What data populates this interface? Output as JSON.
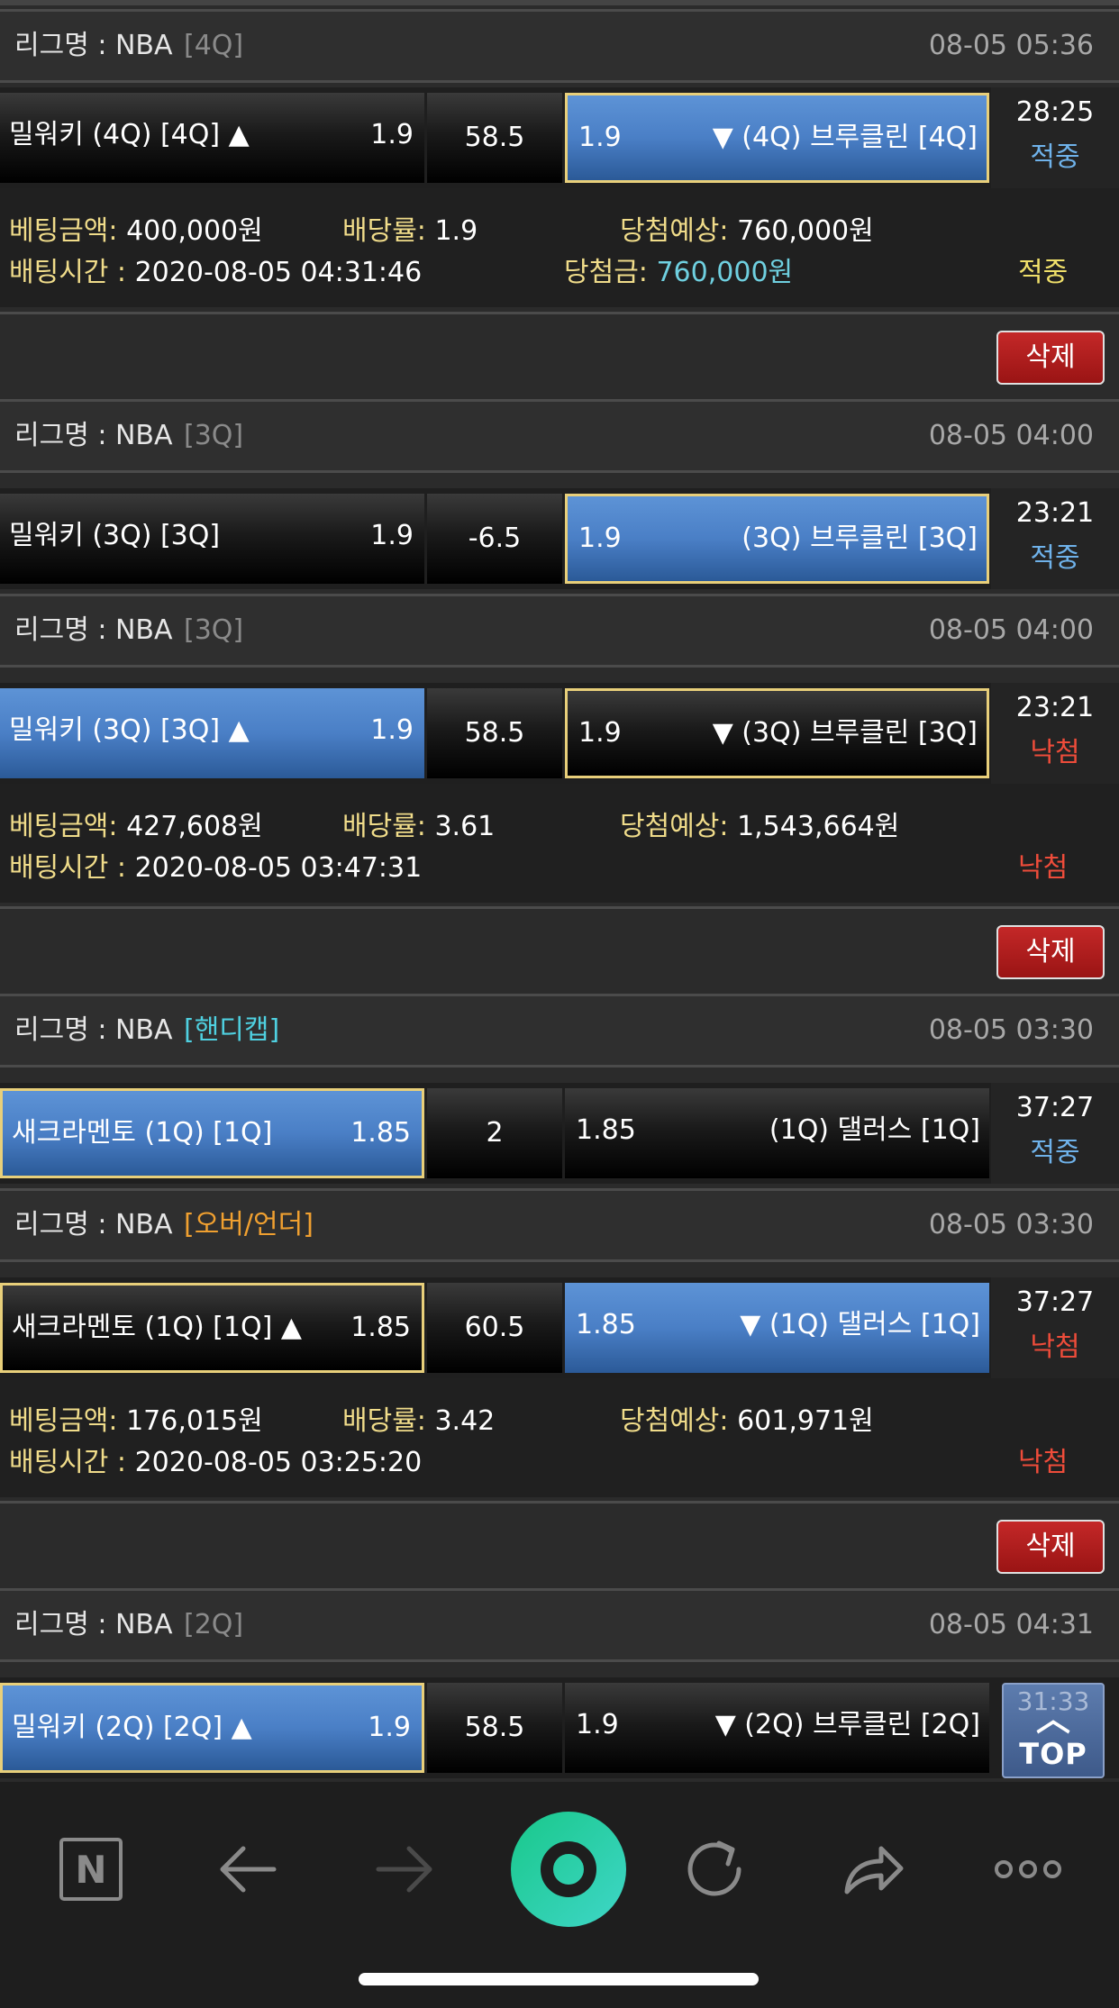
{
  "league_prefix": "리그명 : NBA",
  "bets": [
    {
      "tag": "[4Q]",
      "date": "08-05 05:36",
      "home": "밀워키 (4Q) [4Q] ▲",
      "home_odd": "1.9",
      "line": "58.5",
      "away_odd": "1.9",
      "away": "▼ (4Q) 브루클린 [4Q]",
      "time": "28:25",
      "result": "적중"
    },
    {
      "tag": "[3Q]",
      "date": "08-05 04:00",
      "home": "밀워키 (3Q) [3Q]",
      "home_odd": "1.9",
      "line": "-6.5",
      "away_odd": "1.9",
      "away": "(3Q) 브루클린 [3Q]",
      "time": "23:21",
      "result": "적중"
    },
    {
      "tag": "[3Q]",
      "date": "08-05 04:00",
      "home": "밀워키 (3Q) [3Q] ▲",
      "home_odd": "1.9",
      "line": "58.5",
      "away_odd": "1.9",
      "away": "▼ (3Q) 브루클린 [3Q]",
      "time": "23:21",
      "result": "낙첨"
    },
    {
      "tag": "[핸디캡]",
      "date": "08-05 03:30",
      "home": "새크라멘토 (1Q) [1Q]",
      "home_odd": "1.85",
      "line": "2",
      "away_odd": "1.85",
      "away": "(1Q) 댈러스 [1Q]",
      "time": "37:27",
      "result": "적중"
    },
    {
      "tag": "[오버/언더]",
      "date": "08-05 03:30",
      "home": "새크라멘토 (1Q) [1Q] ▲",
      "home_odd": "1.85",
      "line": "60.5",
      "away_odd": "1.85",
      "away": "▼ (1Q) 댈러스 [1Q]",
      "time": "37:27",
      "result": "낙첨"
    },
    {
      "tag": "[2Q]",
      "date": "08-05 04:31",
      "home": "밀워키 (2Q) [2Q] ▲",
      "home_odd": "1.9",
      "line": "58.5",
      "away_odd": "1.9",
      "away": "▼ (2Q) 브루클린 [2Q]",
      "time": "31:33",
      "result": ""
    }
  ],
  "labels": {
    "bet_amount": "베팅금액:",
    "odds": "배당률:",
    "expected": "당첨예상:",
    "bet_time": "배팅시간 :",
    "winnings": "당첨금:",
    "delete": "삭제",
    "top": "TOP"
  },
  "slips": [
    {
      "amount": "400,000원",
      "odds": "1.9",
      "expected": "760,000원",
      "time": "2020-08-05 04:31:46",
      "winnings": "760,000원",
      "result": "적중"
    },
    {
      "amount": "427,608원",
      "odds": "3.61",
      "expected": "1,543,664원",
      "time": "2020-08-05 03:47:31",
      "winnings": "",
      "result": "낙첨"
    },
    {
      "amount": "176,015원",
      "odds": "3.42",
      "expected": "601,971원",
      "time": "2020-08-05 03:25:20",
      "winnings": "",
      "result": "낙첨"
    }
  ],
  "nav": {
    "icons": [
      "naver-n-icon",
      "back-arrow-icon",
      "forward-arrow-icon",
      "home-ring-icon",
      "refresh-icon",
      "share-icon",
      "more-dots-icon"
    ],
    "n_letter": "N"
  },
  "colors": {
    "selected_blue": "#4a7fc6",
    "selected_border": "#e8cf7a",
    "hit": "#6fb2ea",
    "miss": "#ee4c3a",
    "delete_red": "#b01c1c"
  }
}
